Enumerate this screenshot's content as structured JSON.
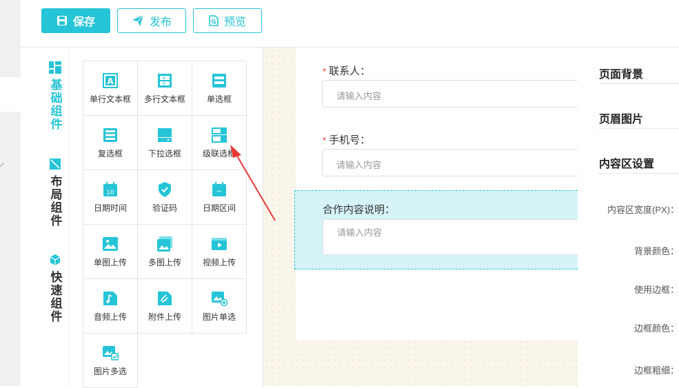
{
  "toolbar": {
    "save_label": "保存",
    "publish_label": "发布",
    "preview_label": "预览"
  },
  "categories": [
    {
      "label": "基础组件",
      "icon": "grid-icon",
      "active": true
    },
    {
      "label": "布局组件",
      "icon": "layout-icon",
      "active": false
    },
    {
      "label": "快速组件",
      "icon": "cube-icon",
      "active": false
    }
  ],
  "components": [
    {
      "label": "单行文本框",
      "icon": "single-text-icon"
    },
    {
      "label": "多行文本框",
      "icon": "multi-text-icon"
    },
    {
      "label": "单选框",
      "icon": "radio-icon"
    },
    {
      "label": "复选框",
      "icon": "checkbox-icon"
    },
    {
      "label": "下拉选框",
      "icon": "dropdown-icon"
    },
    {
      "label": "级联选框",
      "icon": "cascade-icon"
    },
    {
      "label": "日期时间",
      "icon": "calendar-icon"
    },
    {
      "label": "验证码",
      "icon": "shield-icon"
    },
    {
      "label": "日期区间",
      "icon": "date-range-icon"
    },
    {
      "label": "单图上传",
      "icon": "image-icon"
    },
    {
      "label": "多图上传",
      "icon": "images-icon"
    },
    {
      "label": "视频上传",
      "icon": "video-icon"
    },
    {
      "label": "音频上传",
      "icon": "music-icon"
    },
    {
      "label": "附件上传",
      "icon": "paperclip-icon"
    },
    {
      "label": "图片单选",
      "icon": "image-radio-icon"
    },
    {
      "label": "图片多选",
      "icon": "image-check-icon"
    }
  ],
  "form": {
    "contact": {
      "label": "联系人：",
      "required_mark": "*",
      "placeholder": "请输入内容"
    },
    "phone": {
      "label": "手机号：",
      "required_mark": "*",
      "placeholder": "请输入内容"
    },
    "cooperation": {
      "label": "合作内容说明：",
      "placeholder": "请输入内容"
    }
  },
  "settings": {
    "sections": [
      "页面背景",
      "页眉图片",
      "内容区设置"
    ],
    "props": [
      "内容区宽度(PX)：",
      "背景颜色：",
      "使用边框：",
      "边框颜色：",
      "边框粗细："
    ]
  },
  "colors": {
    "accent": "#25c4d6",
    "required": "#ee3333",
    "selected_bg": "#d6f3f7",
    "arrow": "#e53935"
  }
}
